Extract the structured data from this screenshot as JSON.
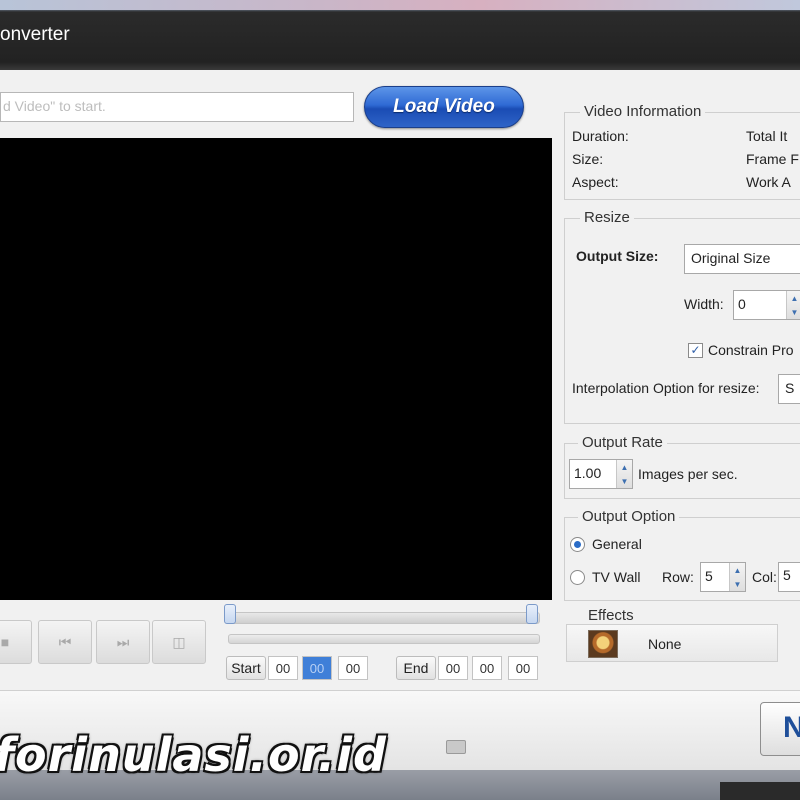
{
  "window": {
    "title": "onverter"
  },
  "toolbar": {
    "file_input_placeholder": "d Video\" to start.",
    "load_button_label": "Load Video"
  },
  "playback": {
    "buttons": [
      {
        "icon": "stop-icon",
        "glyph": "■"
      },
      {
        "icon": "previous-icon",
        "glyph": "⏮"
      },
      {
        "icon": "next-icon",
        "glyph": "⏭"
      },
      {
        "icon": "snapshot-icon",
        "glyph": "◫"
      }
    ],
    "start_label": "Start",
    "end_label": "End",
    "start_time": [
      "00",
      "00",
      "00"
    ],
    "end_time": [
      "00",
      "00",
      "00"
    ]
  },
  "video_info": {
    "legend": "Video Information",
    "duration_label": "Duration:",
    "size_label": "Size:",
    "aspect_label": "Aspect:",
    "total_label": "Total It",
    "frame_label": "Frame F",
    "work_label": "Work A"
  },
  "resize": {
    "legend": "Resize",
    "output_size_label": "Output Size:",
    "output_size_value": "Original Size",
    "width_label": "Width:",
    "width_value": "0",
    "constrain_label": "Constrain Pro",
    "constrain_checked": true,
    "interpolation_label": "Interpolation Option for resize:",
    "interpolation_value": "S"
  },
  "output_rate": {
    "legend": "Output Rate",
    "value": "1.00",
    "unit_label": "Images per sec."
  },
  "output_option": {
    "legend": "Output Option",
    "general_label": "General",
    "tvwall_label": "TV Wall",
    "row_label": "Row:",
    "row_value": "5",
    "col_label": "Col:",
    "col_value": "5",
    "selected": "General"
  },
  "effects": {
    "legend": "Effects",
    "value": "None"
  },
  "footer": {
    "next_button_label": "N",
    "watermark": "forinulasi.or.id"
  },
  "colors": {
    "accent": "#2f6ad4",
    "preview_bg": "#000000"
  }
}
